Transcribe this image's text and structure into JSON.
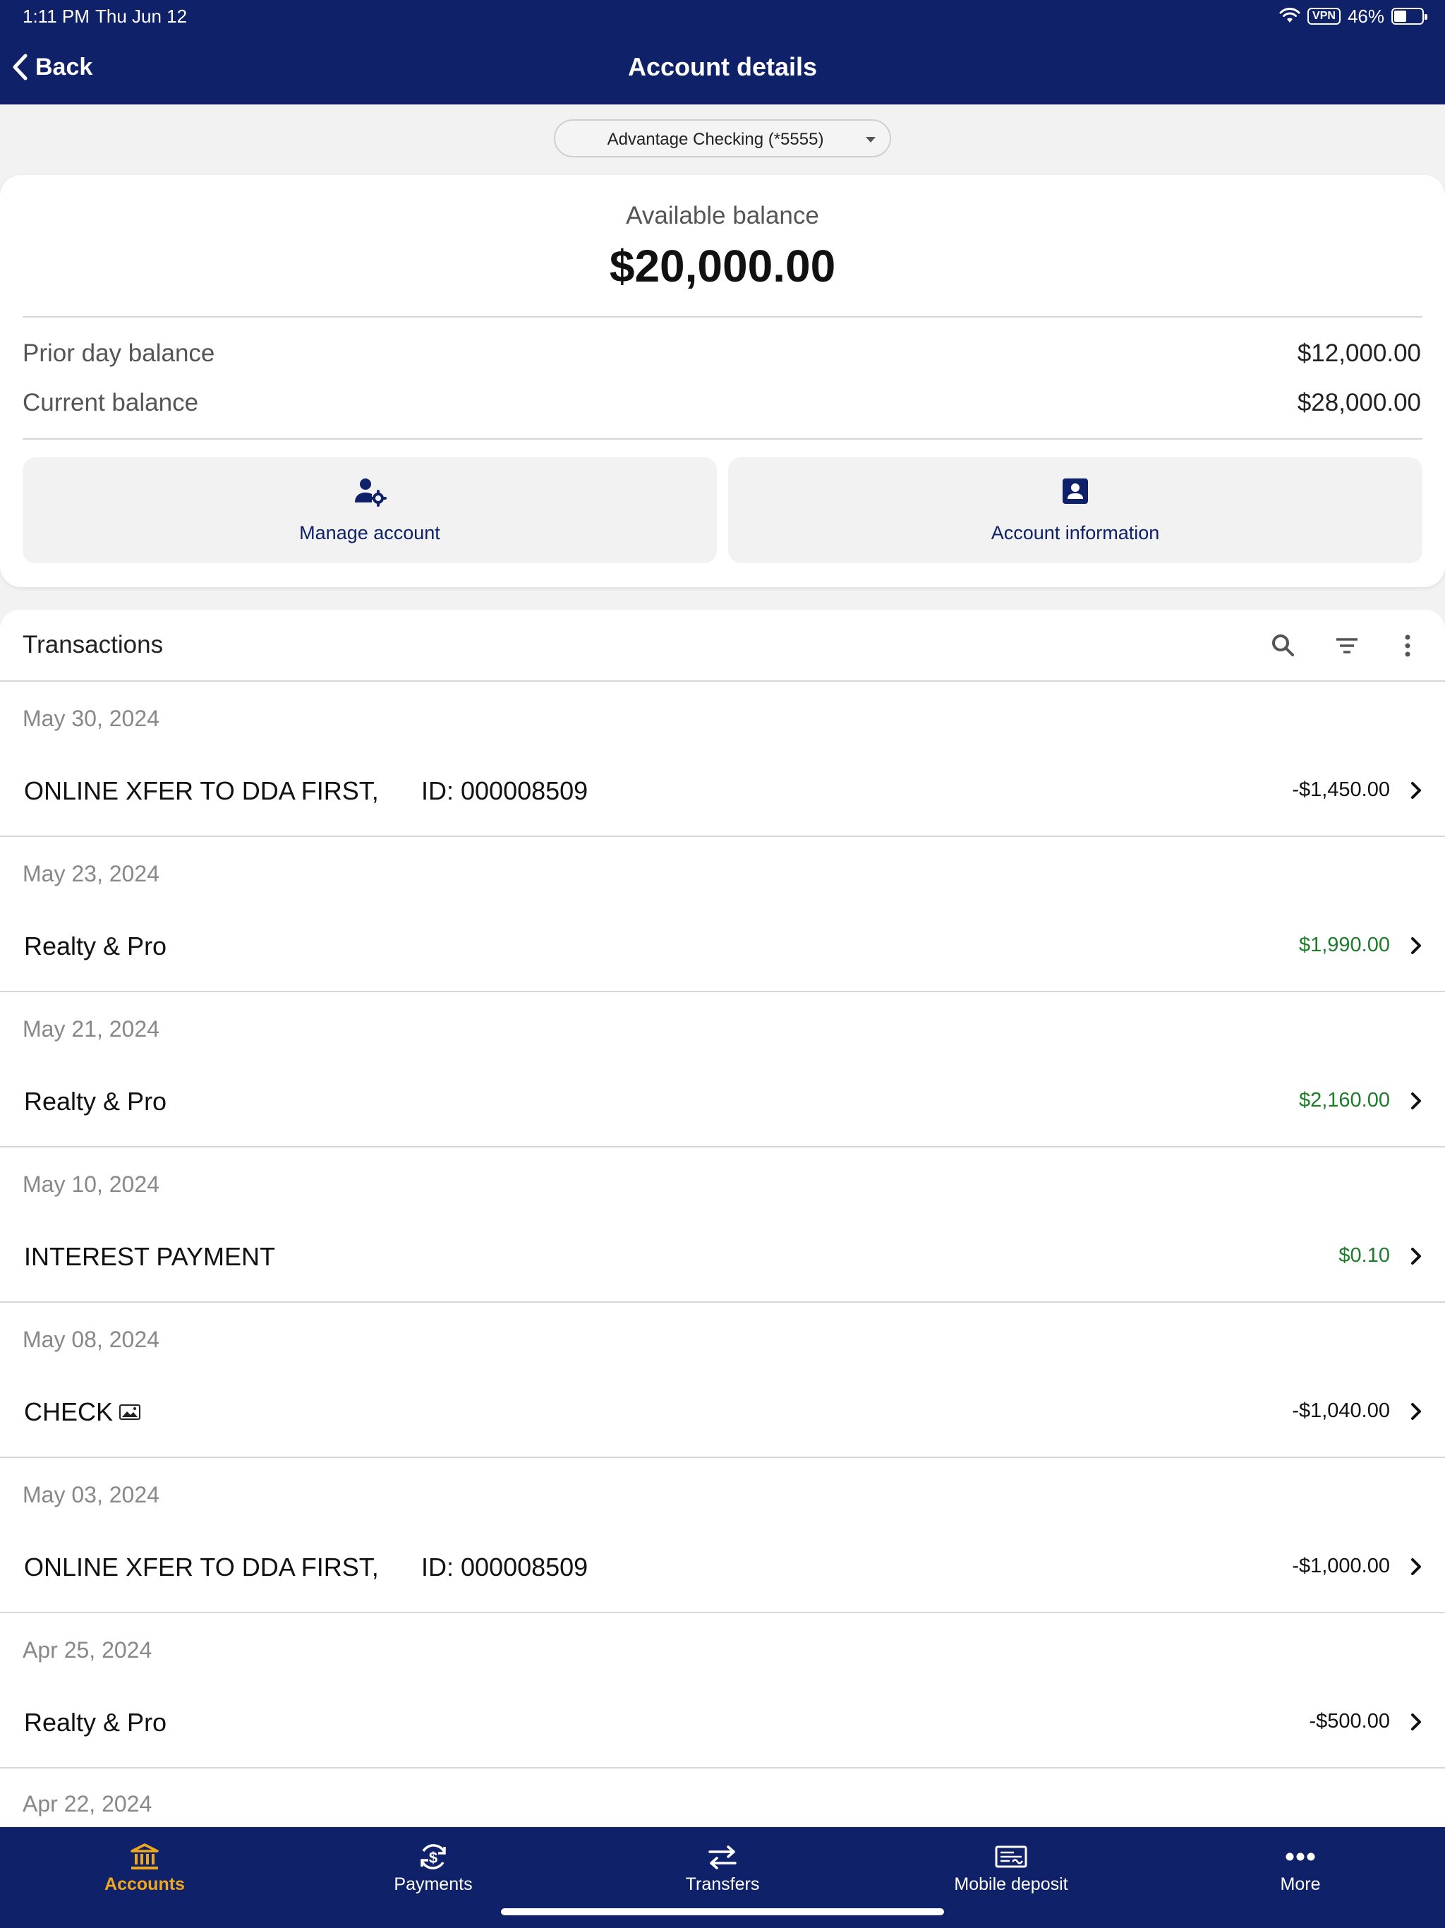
{
  "status_bar": {
    "time": "1:11 PM",
    "date": "Thu Jun 12",
    "vpn": "VPN",
    "battery": "46%",
    "battery_level": 0.46
  },
  "header": {
    "back_label": "Back",
    "title": "Account details"
  },
  "account_selector": {
    "selected": "Advantage Checking (*5555)"
  },
  "balances": {
    "available_label": "Available balance",
    "available_value": "$20,000.00",
    "prior_day_label": "Prior day balance",
    "prior_day_value": "$12,000.00",
    "current_label": "Current balance",
    "current_value": "$28,000.00"
  },
  "actions": {
    "manage_account": "Manage account",
    "account_information": "Account information"
  },
  "transactions": {
    "title": "Transactions",
    "groups": [
      {
        "date": "May 30, 2024",
        "desc": "ONLINE XFER TO DDA FIRST,",
        "id": "ID: 000008509",
        "amount": "-$1,450.00",
        "positive": false
      },
      {
        "date": "May 23, 2024",
        "desc": "Realty & Pro",
        "id": "",
        "amount": "$1,990.00",
        "positive": true
      },
      {
        "date": "May 21, 2024",
        "desc": "Realty & Pro",
        "id": "",
        "amount": "$2,160.00",
        "positive": true
      },
      {
        "date": "May 10, 2024",
        "desc": "INTEREST PAYMENT",
        "id": "",
        "amount": "$0.10",
        "positive": true
      },
      {
        "date": "May 08, 2024",
        "desc": "CHECK",
        "id": "",
        "amount": "-$1,040.00",
        "positive": false,
        "has_image": true
      },
      {
        "date": "May 03, 2024",
        "desc": "ONLINE XFER TO DDA FIRST,",
        "id": "ID: 000008509",
        "amount": "-$1,000.00",
        "positive": false
      },
      {
        "date": "Apr 25, 2024",
        "desc": "Realty & Pro",
        "id": "",
        "amount": "-$500.00",
        "positive": false
      }
    ],
    "trailing_date": "Apr 22, 2024"
  },
  "tabs": [
    {
      "label": "Accounts",
      "icon": "bank-icon",
      "active": true
    },
    {
      "label": "Payments",
      "icon": "payments-icon",
      "active": false
    },
    {
      "label": "Transfers",
      "icon": "transfers-icon",
      "active": false
    },
    {
      "label": "Mobile deposit",
      "icon": "check-deposit-icon",
      "active": false
    },
    {
      "label": "More",
      "icon": "more-icon",
      "active": false
    }
  ],
  "colors": {
    "brand": "#0f2168",
    "active_tab": "#f0a81b",
    "credit": "#1e7c2a"
  }
}
